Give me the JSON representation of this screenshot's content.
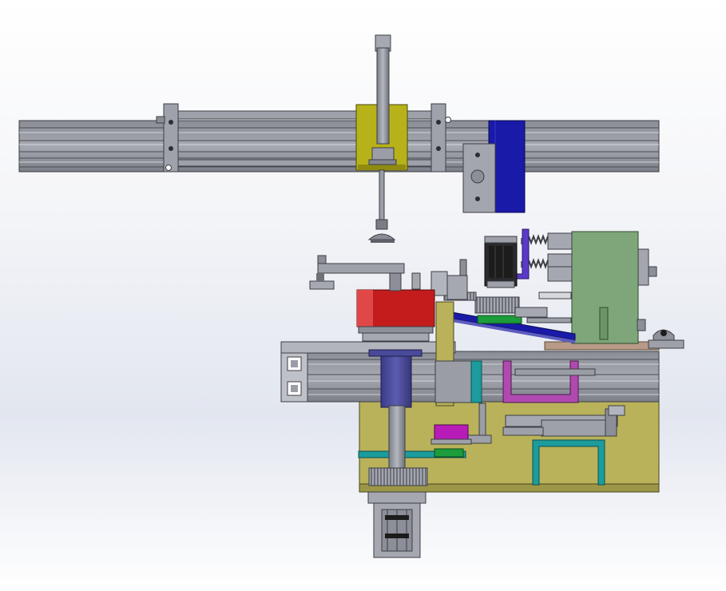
{
  "scene": {
    "background_top": "#ffffff",
    "background_mid": "#e3e7ef",
    "colors": {
      "steel": "#9a9ca6",
      "steel_dark": "#55575f",
      "steel_light": "#c4c6ce",
      "yellow_block": "#b7b21a",
      "blue_block": "#1a1aa8",
      "green_housing": "#7fa67b",
      "red_block": "#c41c1c",
      "olive_base": "#b9b25a",
      "navy_cylinder": "#4a4a9a",
      "teal_frame": "#1c9c9c",
      "magenta_bracket": "#b04ab0",
      "violet_bracket": "#5a3ac8",
      "purple_block": "#b81cb8",
      "green_plate": "#1c9c3a",
      "tan_plate": "#b89a86",
      "motor_black": "#1c1c1c"
    }
  }
}
